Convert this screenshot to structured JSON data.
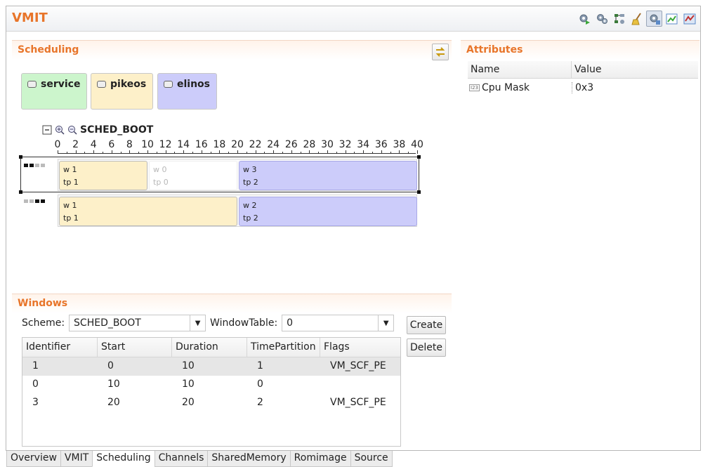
{
  "app": {
    "title": "VMIT"
  },
  "toolbar": {
    "buttons": [
      {
        "icon": "gear-play-icon"
      },
      {
        "icon": "gears-icon"
      },
      {
        "icon": "settings-tree-icon"
      },
      {
        "icon": "broom-icon"
      },
      {
        "icon": "gear-selected-icon",
        "active": true
      },
      {
        "icon": "chart-edit-icon"
      },
      {
        "icon": "chart-graph-icon"
      }
    ]
  },
  "scheduling": {
    "title": "Scheduling",
    "partitions": [
      {
        "label": "service",
        "color": "#ccf5cc"
      },
      {
        "label": "pikeos",
        "color": "#fdf0c9"
      },
      {
        "label": "elinos",
        "color": "#ccccfa"
      }
    ],
    "timeline": {
      "scheme_name": "SCHED_BOOT",
      "ruler_max": 40,
      "ruler_labels": [
        "0",
        "2",
        "4",
        "6",
        "8",
        "10",
        "12",
        "14",
        "16",
        "18",
        "20",
        "22",
        "24",
        "26",
        "28",
        "30",
        "32",
        "34",
        "36",
        "38",
        "40"
      ],
      "tracks": [
        {
          "selected": true,
          "windows": [
            {
              "label1": "w 1",
              "label2": "tp 1",
              "start": 0,
              "duration": 10,
              "style": "yellow"
            },
            {
              "label1": "w 0",
              "label2": "tp 0",
              "start": 10,
              "duration": 10,
              "style": "empty"
            },
            {
              "label1": "w 3",
              "label2": "tp 2",
              "start": 20,
              "duration": 20,
              "style": "purple"
            }
          ]
        },
        {
          "selected": false,
          "windows": [
            {
              "label1": "w 1",
              "label2": "tp 1",
              "start": 0,
              "duration": 20,
              "style": "yellow"
            },
            {
              "label1": "w 2",
              "label2": "tp 2",
              "start": 20,
              "duration": 20,
              "style": "purple"
            }
          ]
        }
      ]
    }
  },
  "windows": {
    "title": "Windows",
    "scheme_label": "Scheme:",
    "scheme_value": "SCHED_BOOT",
    "window_table_label": "WindowTable:",
    "window_table_value": "0",
    "create_label": "Create",
    "delete_label": "Delete",
    "columns": [
      "Identifier",
      "Start",
      "Duration",
      "TimePartition",
      "Flags"
    ],
    "rows": [
      [
        "1",
        "0",
        "10",
        "1",
        "VM_SCF_PE"
      ],
      [
        "0",
        "10",
        "10",
        "0",
        ""
      ],
      [
        "3",
        "20",
        "20",
        "2",
        "VM_SCF_PE"
      ]
    ]
  },
  "attributes": {
    "title": "Attributes",
    "columns": [
      "Name",
      "Value"
    ],
    "rows": [
      {
        "type_badge": "I23",
        "name": "Cpu Mask",
        "value": "0x3"
      }
    ]
  },
  "tabs": [
    "Overview",
    "VMIT",
    "Scheduling",
    "Channels",
    "SharedMemory",
    "Romimage",
    "Source"
  ],
  "active_tab": "Scheduling"
}
